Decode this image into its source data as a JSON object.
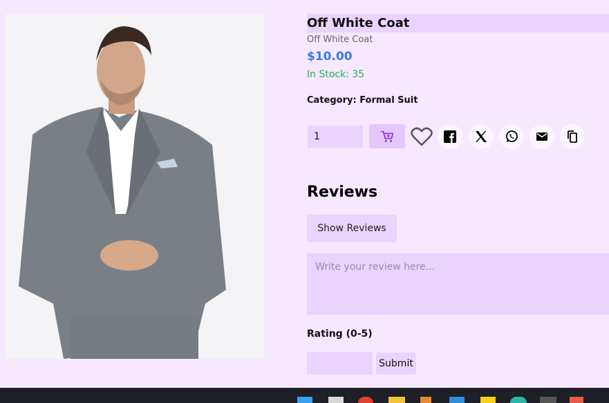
{
  "product": {
    "title": "Off White Coat",
    "subtitle": "Off White Coat",
    "price": "$10.00",
    "stock": "In Stock: 35",
    "category": "Category: Formal Suit",
    "image_icon": "man-in-grey-suit-photo"
  },
  "actions": {
    "quantity": "1",
    "cart_icon": "add-to-cart-icon",
    "wishlist_icon": "heart-icon",
    "share_icons": [
      "facebook-icon",
      "x-icon",
      "whatsapp-icon",
      "email-icon",
      "copy-icon"
    ]
  },
  "reviews": {
    "heading": "Reviews",
    "show_label": "Show Reviews",
    "placeholder": "Write your review here...",
    "rating_label": "Rating (0-5)",
    "rating_value": "",
    "submit_label": "Submit"
  },
  "colors": {
    "background": "#f5e8ff",
    "accent": "#e8d4fd",
    "price": "#3a7be0",
    "stock": "#22b35b",
    "cart_icon": "#8a2be2"
  },
  "taskbar": {
    "icons": [
      "windows-icon",
      "task-view-icon",
      "chrome-icon",
      "file-explorer-icon",
      "pencil-app-icon",
      "vscode-icon",
      "sticky-notes-icon",
      "edge-icon",
      "terminal-icon",
      "calendar-app-icon"
    ]
  }
}
